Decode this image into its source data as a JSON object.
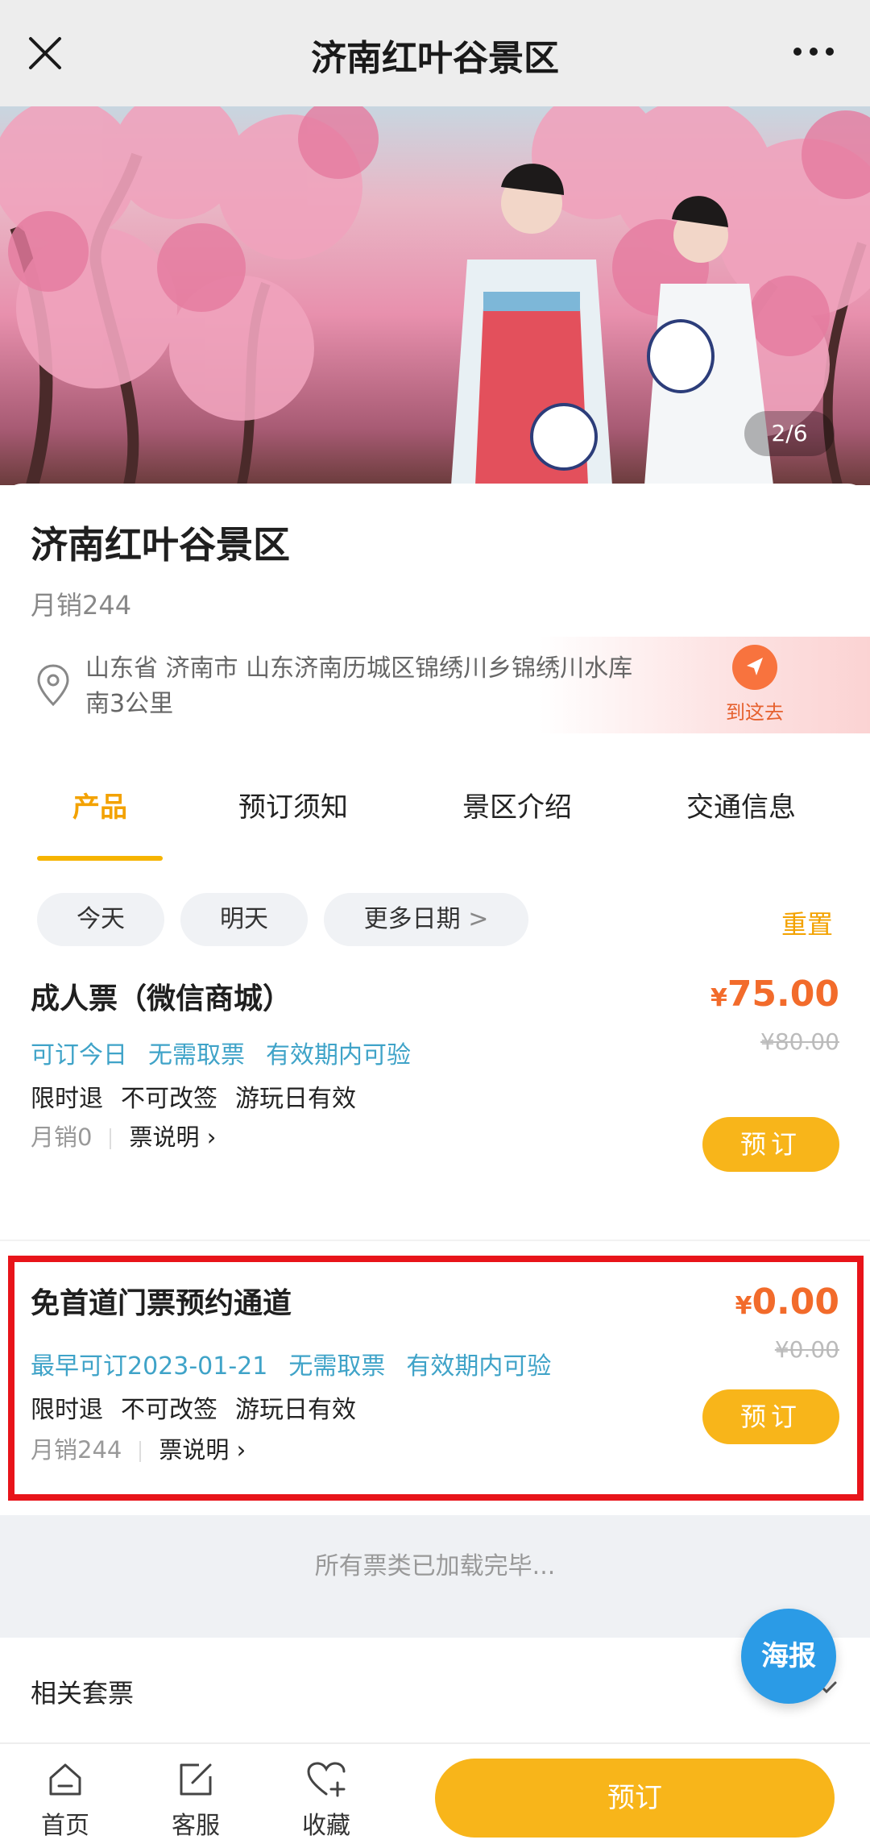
{
  "header": {
    "title": "济南红叶谷景区",
    "close_icon": "close-icon",
    "more_icon": "more-dots-icon"
  },
  "hero": {
    "image_desc_icon": "cherry-blossom-photo",
    "counter": "2/6"
  },
  "spot": {
    "name": "济南红叶谷景区",
    "monthly_sales": "月销244",
    "address_line1": "山东省 济南市 山东济南历城区锦绣川乡锦绣川水库",
    "address_line2": "南3公里",
    "navigate_label": "到这去"
  },
  "tabs": [
    "产品",
    "预订须知",
    "景区介绍",
    "交通信息"
  ],
  "dates": {
    "today": "今天",
    "tomorrow": "明天",
    "more": "更多日期",
    "more_suffix": ">",
    "reset": "重置"
  },
  "tickets": [
    {
      "name": "成人票（微信商城）",
      "tags": [
        "可订今日",
        "无需取票",
        "有效期内可验"
      ],
      "rules": [
        "限时退",
        "不可改签",
        "游玩日有效"
      ],
      "sales": "月销0",
      "desc": "票说明",
      "currency": "¥",
      "price": "75.00",
      "original_price": "¥80.00",
      "book": "预订"
    },
    {
      "name": "免首道门票预约通道",
      "tags": [
        "最早可订2023-01-21",
        "无需取票",
        "有效期内可验"
      ],
      "rules": [
        "限时退",
        "不可改签",
        "游玩日有效"
      ],
      "sales": "月销244",
      "desc": "票说明",
      "currency": "¥",
      "price": "0.00",
      "original_price": "¥0.00",
      "book": "预订"
    }
  ],
  "footer_note": "所有票类已加载完毕...",
  "related": "相关套票",
  "poster": "海报",
  "bottom_bar": {
    "home": "首页",
    "service": "客服",
    "favorite": "收藏",
    "order": "预订"
  },
  "colors": {
    "accent": "#f8b51a",
    "price": "#f26b2b",
    "tag": "#3fa3c8",
    "highlight": "#e8141a"
  }
}
